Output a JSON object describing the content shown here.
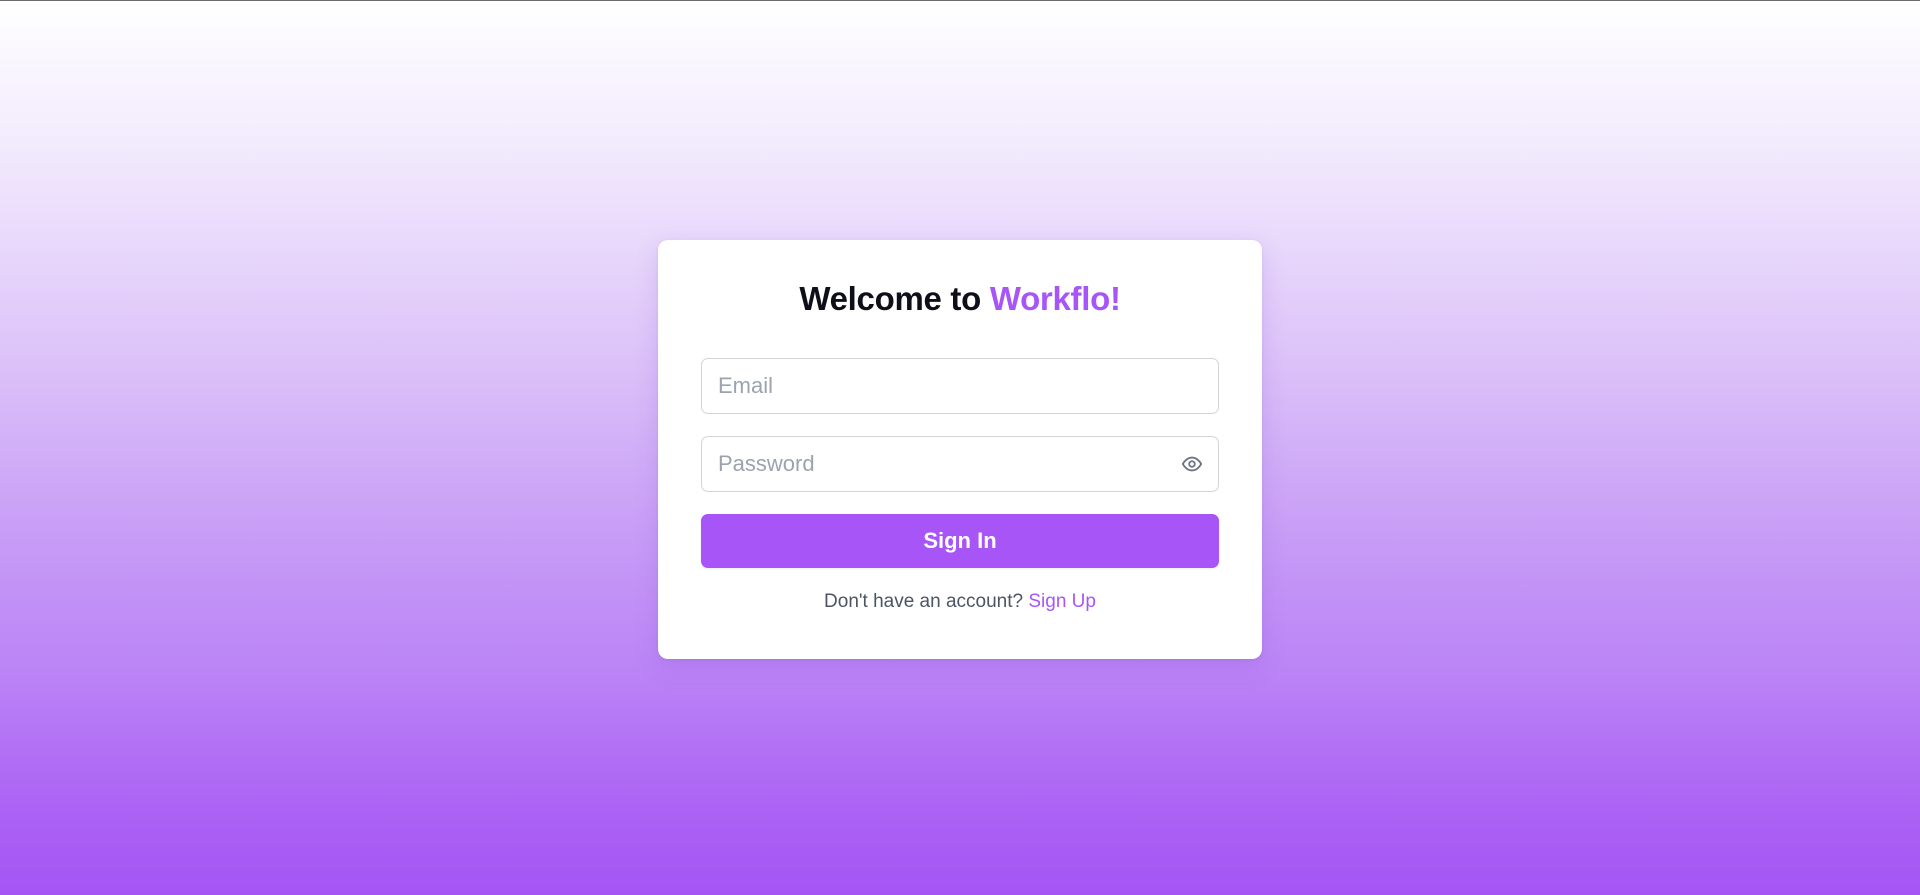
{
  "title": {
    "prefix": "Welcome to ",
    "brand": "Workflo!"
  },
  "form": {
    "email": {
      "placeholder": "Email",
      "value": ""
    },
    "password": {
      "placeholder": "Password",
      "value": "",
      "toggle_icon": "eye-icon"
    },
    "submit_label": "Sign In"
  },
  "footer": {
    "prompt": "Don't have an account? ",
    "link_label": "Sign Up"
  },
  "colors": {
    "accent": "#a855f7",
    "title_text": "#0f0f1a",
    "muted_text": "#4b5563",
    "placeholder": "#9ca3af",
    "background_top": "#ffffff",
    "background_bottom": "#a555f4"
  }
}
